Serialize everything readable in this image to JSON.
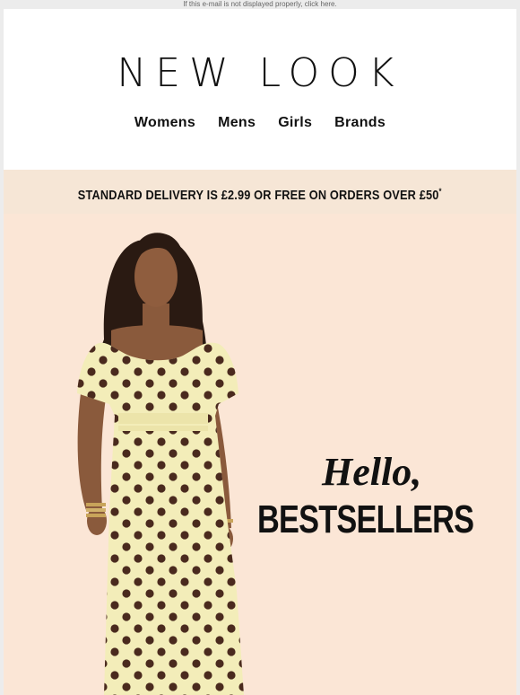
{
  "preheader": {
    "text": "If this e-mail is not displayed properly, click here."
  },
  "header": {
    "logo_text": "NEW LOOK",
    "nav": [
      {
        "label": "Womens"
      },
      {
        "label": "Mens"
      },
      {
        "label": "Girls"
      },
      {
        "label": "Brands"
      }
    ]
  },
  "banner": {
    "delivery_text": "STANDARD DELIVERY IS £2.99 OR FREE ON ORDERS OVER £50",
    "asterisk": "*"
  },
  "hero": {
    "headline_script": "Hello,",
    "headline_main": "BESTSELLERS",
    "colors": {
      "background": "#fbe6d6",
      "dress": "#f3edb9",
      "dots": "#4a2a1e",
      "skin": "#8a5a3c",
      "hair": "#2a1a12"
    }
  }
}
